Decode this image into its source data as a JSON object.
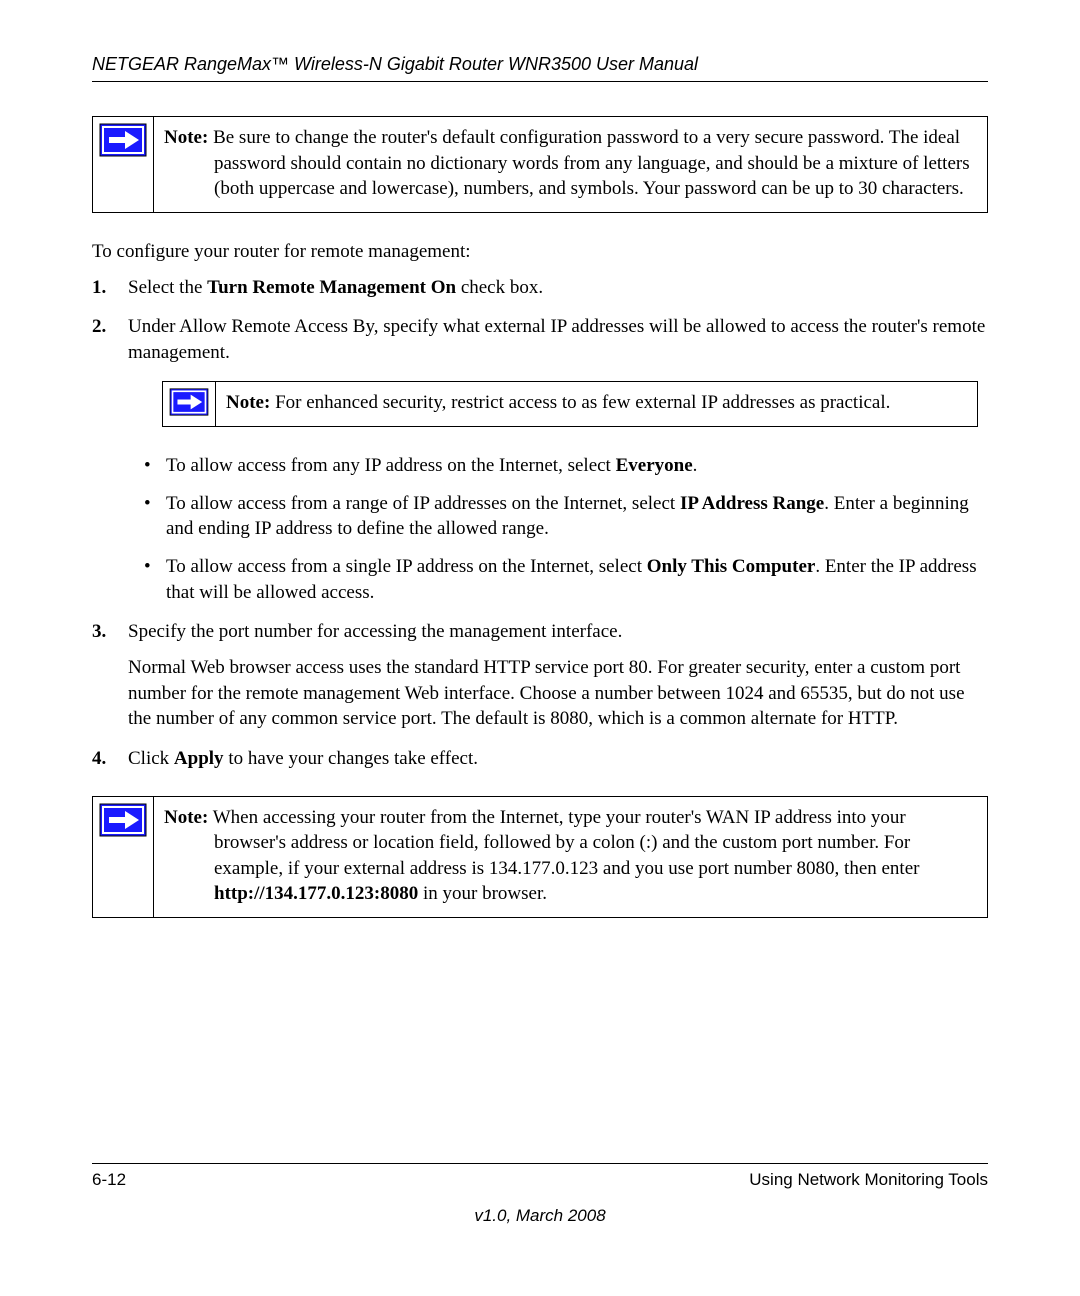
{
  "header": "NETGEAR RangeMax™ Wireless-N Gigabit Router WNR3500 User Manual",
  "note1": {
    "label": "Note:",
    "text": " Be sure to change the router's default configuration password to a very secure password. The ideal password should contain no dictionary words from any language, and should be a mixture of letters (both uppercase and lowercase), numbers, and symbols. Your password can be up to 30 characters."
  },
  "intro": "To configure your router for remote management:",
  "step1": {
    "pre": "Select the ",
    "bold": "Turn Remote Management On",
    "post": " check box."
  },
  "step2": "Under Allow Remote Access By, specify what external IP addresses will be allowed to access the router's remote management.",
  "note2": {
    "label": "Note:",
    "text": " For enhanced security, restrict access to as few external IP addresses as practical."
  },
  "bullet1": {
    "pre": "To allow access from any IP address on the Internet, select ",
    "bold": "Everyone",
    "post": "."
  },
  "bullet2": {
    "pre": "To allow access from a range of IP addresses on the Internet, select ",
    "bold": "IP Address Range",
    "post": ". Enter a beginning and ending IP address to define the allowed range."
  },
  "bullet3": {
    "pre": "To allow access from a single IP address on the Internet, select ",
    "bold": "Only This Computer",
    "post": ". Enter the IP address that will be allowed access."
  },
  "step3": {
    "main": "Specify the port number for accessing the management interface.",
    "para": "Normal Web browser access uses the standard HTTP service port 80. For greater security, enter a custom port number for the remote management Web interface. Choose a number between 1024 and 65535, but do not use the number of any common service port. The default is 8080, which is a common alternate for HTTP."
  },
  "step4": {
    "pre": "Click ",
    "bold": "Apply",
    "post": " to have your changes take effect."
  },
  "note3": {
    "label": "Note:",
    "pre": " When accessing your router from the Internet, type your router's WAN IP address into your browser's address or location field, followed by a colon (:) and the custom port number. For example, if your external address is 134.177.0.123 and you use port number 8080, then enter ",
    "bold": "http://134.177.0.123:8080",
    "post": " in your browser."
  },
  "footer": {
    "page": "6-12",
    "section": "Using Network Monitoring Tools",
    "version": "v1.0, March 2008"
  }
}
